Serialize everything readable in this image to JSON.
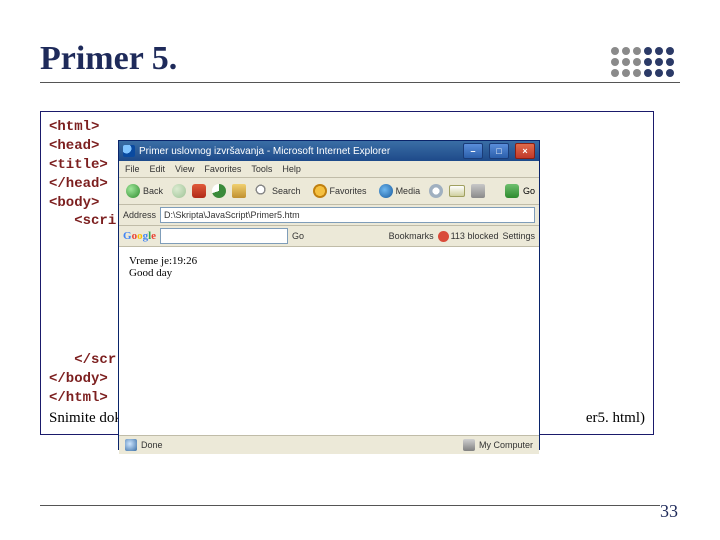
{
  "slide": {
    "title": "Primer 5.",
    "page_number": "33"
  },
  "code": {
    "l1": "<html>",
    "l2": "<head>",
    "l3": "<title>",
    "l4": "</head>",
    "l5": "<body>",
    "l6_indent": "   ",
    "l6": "<scri",
    "b1_indent": "   ",
    "b1": "</scr",
    "b2": "</body>",
    "b3": "</html>",
    "note_prefix": "Snimite dok",
    "note_tail": "er5. html)"
  },
  "ie": {
    "title": "Primer uslovnog izvršavanja - Microsoft Internet Explorer",
    "menu": {
      "file": "File",
      "edit": "Edit",
      "view": "View",
      "favorites": "Favorites",
      "tools": "Tools",
      "help": "Help"
    },
    "toolbar": {
      "back": "Back",
      "search": "Search",
      "favorites": "Favorites",
      "media": "Media",
      "go": "Go"
    },
    "address_label": "Address",
    "address_value": "D:\\Skripta\\JavaScript\\Primer5.htm",
    "google": {
      "go": "Go",
      "bookmarks": "Bookmarks",
      "popups": "113 blocked",
      "settings": "Settings"
    },
    "content": {
      "line1": "Vreme je:19:26",
      "line2": "Good day"
    },
    "status": {
      "done": "Done",
      "zone": "My Computer"
    }
  }
}
